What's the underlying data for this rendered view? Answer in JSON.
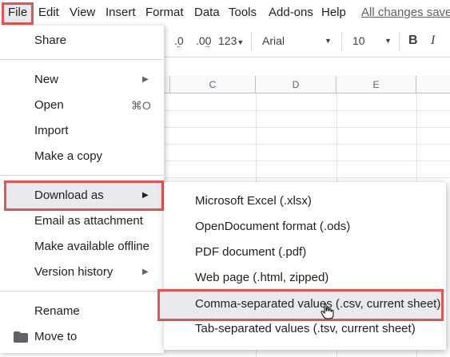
{
  "menubar": {
    "file": "File",
    "edit": "Edit",
    "view": "View",
    "insert": "Insert",
    "format": "Format",
    "data": "Data",
    "tools": "Tools",
    "addons": "Add-ons",
    "help": "Help",
    "saved": "All changes saved"
  },
  "toolbar": {
    "decrease_decimal": ".0",
    "increase_decimal": ".00",
    "more_formats": "123",
    "font": "Arial",
    "font_size": "10",
    "bold": "B",
    "italic": "I"
  },
  "grid": {
    "columns": [
      "C",
      "D",
      "E"
    ]
  },
  "file_menu": {
    "share": "Share",
    "new": "New",
    "open": "Open",
    "open_shortcut": "⌘O",
    "import": "Import",
    "make_copy": "Make a copy",
    "download_as": "Download as",
    "email_attachment": "Email as attachment",
    "make_offline": "Make available offline",
    "version_history": "Version history",
    "rename": "Rename",
    "move_to": "Move to"
  },
  "download_menu": {
    "items": [
      "Microsoft Excel (.xlsx)",
      "OpenDocument format (.ods)",
      "PDF document (.pdf)",
      "Web page (.html, zipped)",
      "Comma-separated values (.csv, current sheet)",
      "Tab-separated values (.tsv, current sheet)"
    ]
  },
  "colors": {
    "highlight_border": "#e8534f",
    "hover_bg": "#e8eaed"
  }
}
